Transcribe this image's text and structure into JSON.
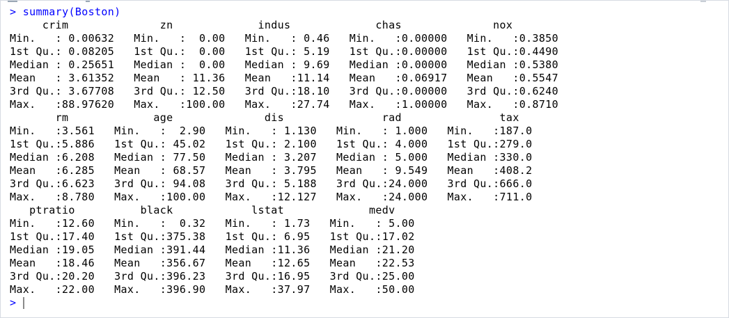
{
  "prompt_symbol": ">",
  "command": "summary(Boston)",
  "output_lines": [
    "     crim              zn             indus             chas              nox       ",
    "Min.   : 0.00632   Min.   :  0.00   Min.   : 0.46   Min.   :0.00000   Min.   :0.3850  ",
    "1st Qu.: 0.08205   1st Qu.:  0.00   1st Qu.: 5.19   1st Qu.:0.00000   1st Qu.:0.4490  ",
    "Median : 0.25651   Median :  0.00   Median : 9.69   Median :0.00000   Median :0.5380  ",
    "Mean   : 3.61352   Mean   : 11.36   Mean   :11.14   Mean   :0.06917   Mean   :0.5547  ",
    "3rd Qu.: 3.67708   3rd Qu.: 12.50   3rd Qu.:18.10   3rd Qu.:0.00000   3rd Qu.:0.6240  ",
    "Max.   :88.97620   Max.   :100.00   Max.   :27.74   Max.   :1.00000   Max.   :0.8710  ",
    "       rm             age              dis               rad               tax       ",
    "Min.   :3.561   Min.   :  2.90   Min.   : 1.130   Min.   : 1.000   Min.   :187.0  ",
    "1st Qu.:5.886   1st Qu.: 45.02   1st Qu.: 2.100   1st Qu.: 4.000   1st Qu.:279.0  ",
    "Median :6.208   Median : 77.50   Median : 3.207   Median : 5.000   Median :330.0  ",
    "Mean   :6.285   Mean   : 68.57   Mean   : 3.795   Mean   : 9.549   Mean   :408.2  ",
    "3rd Qu.:6.623   3rd Qu.: 94.08   3rd Qu.: 5.188   3rd Qu.:24.000   3rd Qu.:666.0  ",
    "Max.   :8.780   Max.   :100.00   Max.   :12.127   Max.   :24.000   Max.   :711.0  ",
    "   ptratio          black            lstat             medv      ",
    "Min.   :12.60   Min.   :  0.32   Min.   : 1.73   Min.   : 5.00  ",
    "1st Qu.:17.40   1st Qu.:375.38   1st Qu.: 6.95   1st Qu.:17.02  ",
    "Median :19.05   Median :391.44   Median :11.36   Median :21.20  ",
    "Mean   :18.46   Mean   :356.67   Mean   :12.65   Mean   :22.53  ",
    "3rd Qu.:20.20   3rd Qu.:396.23   3rd Qu.:16.95   3rd Qu.:25.00  ",
    "Max.   :22.00   Max.   :396.90   Max.   :37.97   Max.   :50.00  "
  ],
  "input_prompt": ">",
  "colors": {
    "command": "#0000ff",
    "output": "#000000",
    "background": "#ffffff"
  }
}
